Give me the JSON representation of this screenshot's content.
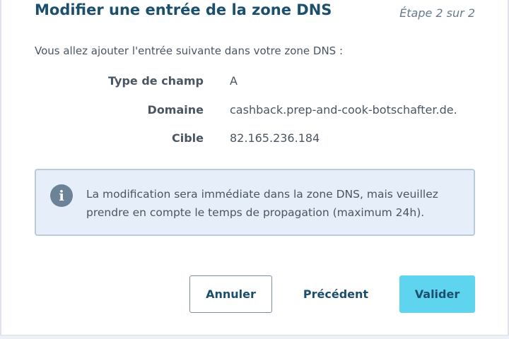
{
  "dialog": {
    "title": "Modifier une entrée de la zone DNS",
    "step": "Étape 2 sur 2",
    "intro": "Vous allez ajouter l'entrée suivante dans votre zone DNS :"
  },
  "record": {
    "type_label": "Type de champ",
    "type_value": "A",
    "domain_label": "Domaine",
    "domain_value": "cashback.prep-and-cook-botschafter.de.",
    "target_label": "Cible",
    "target_value": "82.165.236.184"
  },
  "info": {
    "icon": "info-icon",
    "line1": "La modification sera immédiate dans la zone DNS, mais veuillez",
    "line2": "prendre en compte le temps de propagation (maximum 24h)."
  },
  "buttons": {
    "cancel": "Annuler",
    "previous": "Précédent",
    "submit": "Valider"
  },
  "colors": {
    "title": "#1b4f6d",
    "info_bg": "#e5eef9",
    "primary_button": "#5fd4ef"
  }
}
